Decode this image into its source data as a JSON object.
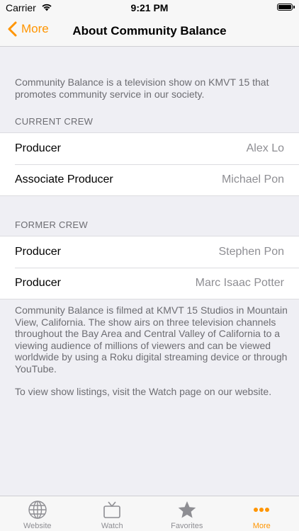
{
  "status_bar": {
    "carrier": "Carrier",
    "time": "9:21 PM",
    "battery_level": 1.0
  },
  "nav": {
    "back_label": "More",
    "title": "About Community Balance"
  },
  "intro_text": "Community Balance is a television show on KMVT 15 that promotes community service in our society.",
  "current_crew": {
    "header": "CURRENT CREW",
    "rows": [
      {
        "role": "Producer",
        "name": "Alex Lo"
      },
      {
        "role": "Associate Producer",
        "name": "Michael Pon"
      }
    ]
  },
  "former_crew": {
    "header": "FORMER CREW",
    "rows": [
      {
        "role": "Producer",
        "name": "Stephen Pon"
      },
      {
        "role": "Producer",
        "name": "Marc Isaac Potter"
      }
    ]
  },
  "footer": {
    "paragraph1": "Community Balance is filmed at KMVT 15 Studios in Mountain View, California.  The show airs on three television channels throughout the Bay Area and Central Valley of California to a viewing audience of millions of viewers and can be viewed worldwide by using a Roku digital streaming device or through YouTube.",
    "paragraph2": "To view show listings, visit the Watch page on our website."
  },
  "tabs": [
    {
      "label": "Website",
      "icon": "globe-icon"
    },
    {
      "label": "Watch",
      "icon": "tv-icon"
    },
    {
      "label": "Favorites",
      "icon": "star-icon"
    },
    {
      "label": "More",
      "icon": "more-icon",
      "active": true
    }
  ],
  "colors": {
    "accent": "#ff9500",
    "inactive": "#8e8e93",
    "background": "#efeff4"
  }
}
